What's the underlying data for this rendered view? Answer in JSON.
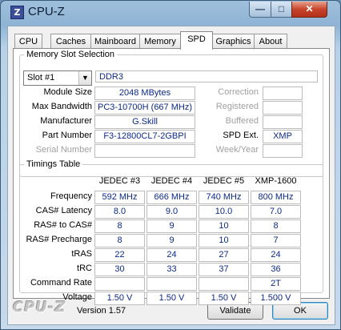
{
  "window": {
    "title": "CPU-Z"
  },
  "tabs": [
    "CPU",
    "Caches",
    "Mainboard",
    "Memory",
    "SPD",
    "Graphics",
    "About"
  ],
  "active_tab": "SPD",
  "slot_selection": {
    "legend": "Memory Slot Selection",
    "slot_value": "Slot #1",
    "memory_type": "DDR3",
    "rows": [
      {
        "label": "Module Size",
        "value": "2048 MBytes",
        "right_label": "Correction",
        "right_value": ""
      },
      {
        "label": "Max Bandwidth",
        "value": "PC3-10700H (667 MHz)",
        "right_label": "Registered",
        "right_value": ""
      },
      {
        "label": "Manufacturer",
        "value": "G.Skill",
        "right_label": "Buffered",
        "right_value": ""
      },
      {
        "label": "Part Number",
        "value": "F3-12800CL7-2GBPI",
        "right_label": "SPD Ext.",
        "right_value": "XMP"
      },
      {
        "label": "Serial Number",
        "value": "",
        "right_label": "Week/Year",
        "right_value": ""
      }
    ]
  },
  "timings": {
    "legend": "Timings Table",
    "columns": [
      "JEDEC #3",
      "JEDEC #4",
      "JEDEC #5",
      "XMP-1600"
    ],
    "rows": [
      {
        "label": "Frequency",
        "values": [
          "592 MHz",
          "666 MHz",
          "740 MHz",
          "800 MHz"
        ]
      },
      {
        "label": "CAS# Latency",
        "values": [
          "8.0",
          "9.0",
          "10.0",
          "7.0"
        ]
      },
      {
        "label": "RAS# to CAS#",
        "values": [
          "8",
          "9",
          "10",
          "8"
        ]
      },
      {
        "label": "RAS# Precharge",
        "values": [
          "8",
          "9",
          "10",
          "7"
        ]
      },
      {
        "label": "tRAS",
        "values": [
          "22",
          "24",
          "27",
          "24"
        ]
      },
      {
        "label": "tRC",
        "values": [
          "30",
          "33",
          "37",
          "36"
        ]
      },
      {
        "label": "Command Rate",
        "values": [
          "",
          "",
          "",
          "2T"
        ]
      },
      {
        "label": "Voltage",
        "values": [
          "1.50 V",
          "1.50 V",
          "1.50 V",
          "1.500 V"
        ]
      }
    ]
  },
  "footer": {
    "brand": "CPU-Z",
    "version": "Version 1.57",
    "validate_label": "Validate",
    "ok_label": "OK"
  }
}
